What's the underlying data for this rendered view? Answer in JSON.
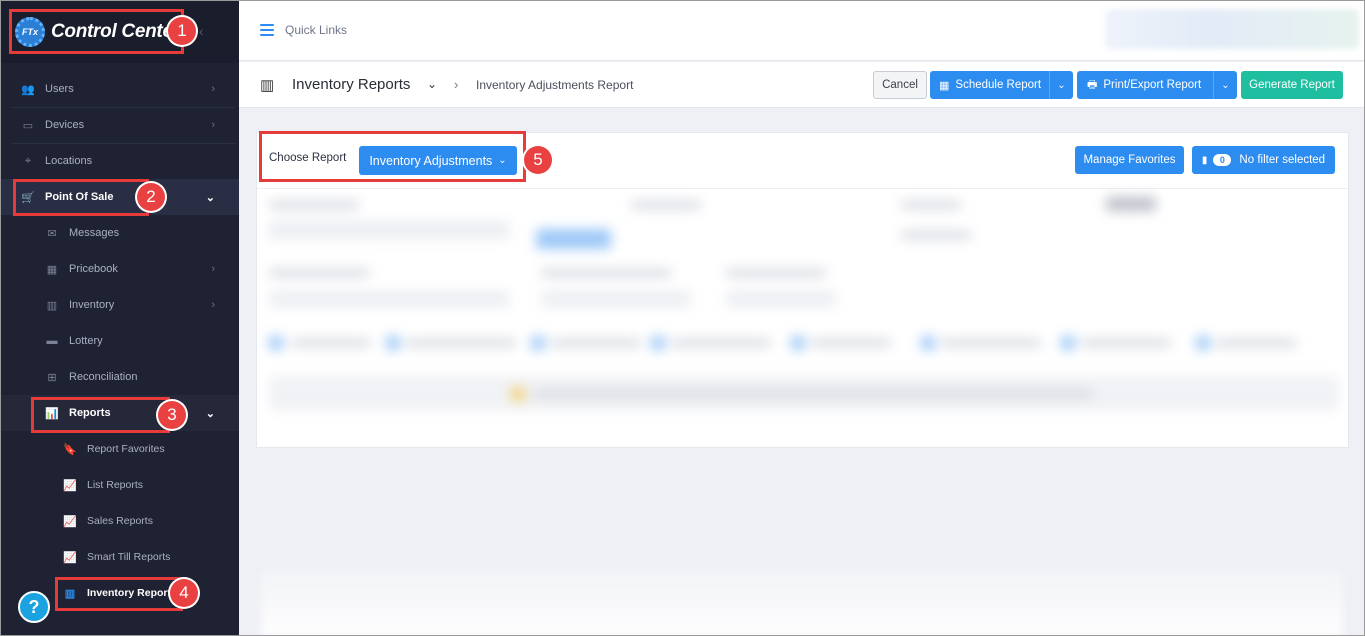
{
  "sidebar": {
    "logo": {
      "badge": "FTx",
      "text": "Control Center"
    },
    "items": [
      {
        "label": "Users",
        "icon": "users-icon"
      },
      {
        "label": "Devices",
        "icon": "devices-icon"
      },
      {
        "label": "Locations",
        "icon": "location-pin-icon"
      },
      {
        "label": "Point Of Sale",
        "icon": "cart-icon"
      },
      {
        "label": "Messages",
        "icon": "envelope-icon"
      },
      {
        "label": "Pricebook",
        "icon": "calculator-icon"
      },
      {
        "label": "Inventory",
        "icon": "warehouse-icon"
      },
      {
        "label": "Lottery",
        "icon": "ticket-icon"
      },
      {
        "label": "Reconciliation",
        "icon": "grid-icon"
      },
      {
        "label": "Reports",
        "icon": "bar-chart-icon"
      },
      {
        "label": "Report Favorites",
        "icon": "bookmark-icon"
      },
      {
        "label": "List Reports",
        "icon": "line-chart-icon"
      },
      {
        "label": "Sales Reports",
        "icon": "line-chart-icon"
      },
      {
        "label": "Smart Till Reports",
        "icon": "line-chart-icon"
      },
      {
        "label": "Inventory Reports",
        "icon": "warehouse-icon"
      }
    ],
    "help": "?"
  },
  "topbar": {
    "quick_links": "Quick Links"
  },
  "header": {
    "title": "Inventory Reports",
    "breadcrumb_current": "Inventory Adjustments Report",
    "cancel": "Cancel",
    "schedule": "Schedule Report",
    "print_export": "Print/Export Report",
    "generate": "Generate Report"
  },
  "report": {
    "choose_label": "Choose Report",
    "selected": "Inventory Adjustments",
    "manage_favorites": "Manage Favorites",
    "filter_count": "0",
    "filter_label": "No filter selected"
  },
  "callouts": [
    "1",
    "2",
    "3",
    "4",
    "5"
  ],
  "colors": {
    "accent": "#2d8cf0",
    "green": "#1ebfa0",
    "sidebar": "#1f2232",
    "callout": "#e53b3b"
  }
}
